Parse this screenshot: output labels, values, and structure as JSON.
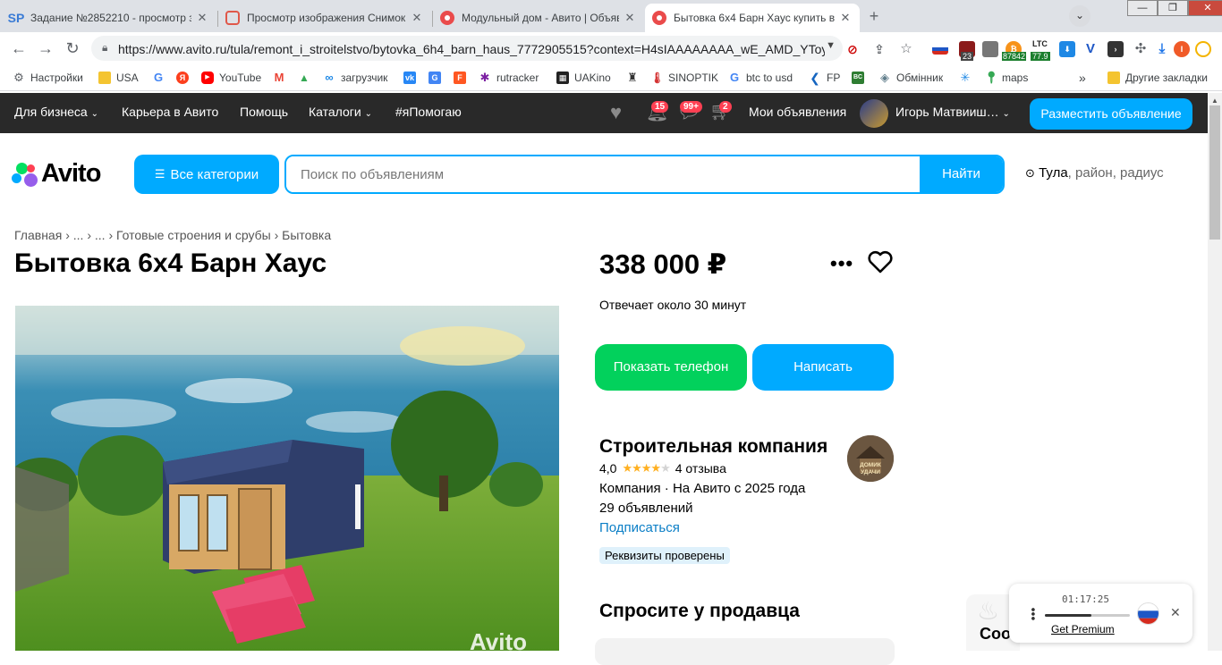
{
  "browser": {
    "tabs": [
      {
        "title": "Задание №2852210 - просмотр з",
        "favicon_text": "SP",
        "favicon_color": "#3a7bd5",
        "active": false
      },
      {
        "title": "Просмотр изображения Снимок",
        "favicon_text": "",
        "favicon_color": "#e0584a",
        "active": false
      },
      {
        "title": "Модульный дом - Авито | Объявл",
        "favicon_text": "",
        "favicon_color": "#ea4b4b",
        "active": false
      },
      {
        "title": "Бытовка 6х4 Барн Хаус купить в Т",
        "favicon_text": "",
        "favicon_color": "#ea4b4b",
        "active": true
      }
    ],
    "tab_close_glyph": "✕",
    "new_tab_glyph": "+",
    "profile_initial": "I",
    "window_controls": {
      "minimize": "—",
      "maximize": "❐",
      "close": "✕"
    },
    "url": "https://www.avito.ru/tula/remont_i_stroitelstvo/bytovka_6h4_barn_haus_7772905515?context=H4sIAAAAAAAA_wE_AMD_YToy...",
    "nav": {
      "back": "←",
      "forward": "→",
      "reload": "↻"
    },
    "extensions": [
      {
        "label": "23",
        "color": "#b22"
      },
      {
        "label": "87842",
        "color": "#1b7f2e"
      },
      {
        "label": "77.9",
        "color": "#1b7f2e"
      },
      {
        "label": "LTC",
        "color": "#444"
      }
    ],
    "bookmarks": [
      {
        "label": "Настройки",
        "icon": "gear-icon",
        "color": "#5f6368"
      },
      {
        "label": "USA",
        "icon": "folder-icon",
        "color": "#f4c430"
      },
      {
        "label": "",
        "icon": "google-icon",
        "color": "#4285f4"
      },
      {
        "label": "",
        "icon": "yandex-icon",
        "color": "#fc3f1d"
      },
      {
        "label": "YouTube",
        "icon": "youtube-icon",
        "color": "#ff0000"
      },
      {
        "label": "",
        "icon": "gmail-icon",
        "color": "#ea4335"
      },
      {
        "label": "",
        "icon": "drive-icon",
        "color": "#34a853"
      },
      {
        "label": "загрузчик",
        "icon": "link-icon",
        "color": "#1e88e5"
      },
      {
        "label": "",
        "icon": "vk-icon",
        "color": "#2787f5"
      },
      {
        "label": "",
        "icon": "translate-icon",
        "color": "#4285f4"
      },
      {
        "label": "",
        "icon": "f-icon",
        "color": "#ff5722"
      },
      {
        "label": "rutracker",
        "icon": "rutracker-icon",
        "color": "#7b1fa2"
      },
      {
        "label": "UAKino",
        "icon": "uakino-icon",
        "color": "#222"
      },
      {
        "label": "",
        "icon": "bookmark-icon",
        "color": "#333"
      },
      {
        "label": "SINOPTIK",
        "icon": "thermometer-icon",
        "color": "#d32f2f"
      },
      {
        "label": "btc to usd",
        "icon": "google-icon",
        "color": "#4285f4"
      },
      {
        "label": "FP",
        "icon": "fp-icon",
        "color": "#1565c0"
      },
      {
        "label": "",
        "icon": "bc-icon",
        "color": "#2e7d32"
      },
      {
        "label": "Обмінник",
        "icon": "exchange-icon",
        "color": "#607d8b"
      },
      {
        "label": "",
        "icon": "star-burst-icon",
        "color": "#1e88e5"
      },
      {
        "label": "maps",
        "icon": "maps-icon",
        "color": "#34a853"
      }
    ],
    "bookmarks_overflow": "»",
    "other_bookmarks": "Другие закладки"
  },
  "avito": {
    "topnav": {
      "business": "Для бизнеса",
      "career": "Карьера в Авито",
      "help": "Помощь",
      "catalogs": "Каталоги",
      "help_tag": "#яПомогаю",
      "notifications_badge": "15",
      "messages_badge": "99+",
      "cart_badge": "2",
      "my_ads": "Мои объявления",
      "user_name": "Игорь Матвииш…",
      "place_ad": "Разместить объявление"
    },
    "logo": "Avito",
    "all_categories": "Все категории",
    "search": {
      "placeholder": "Поиск по объявлениям",
      "button": "Найти"
    },
    "location": {
      "city": "Тула",
      "suffix": ", район, радиус"
    },
    "breadcrumb": [
      "Главная",
      "...",
      "...",
      "Готовые строения и срубы",
      "Бытовка"
    ],
    "breadcrumb_sep": "›",
    "title": "Бытовка 6х4 Барн Хаус",
    "price": "338 000 ₽",
    "response_time": "Отвечает около 30 минут",
    "show_phone": "Показать телефон",
    "write": "Написать",
    "seller": {
      "name": "Строительная компания",
      "rating": "4,0",
      "stars": 4,
      "reviews": "4 отзыва",
      "type_line": "Компания · На Авито с 2025 года",
      "ads_count": "29 объявлений",
      "subscribe": "Подписаться",
      "verified": "Реквизиты проверены",
      "avatar_text": "ДОМИК УДАЧИ"
    },
    "ask_seller": "Спросите у продавца",
    "photo_watermark": "Avito",
    "cookie_peek": "Coo"
  },
  "player_widget": {
    "time": "01:17:25",
    "progress": 0.55,
    "premium": "Get Premium"
  },
  "colors": {
    "accent": "#00aaff",
    "green": "#02d15c",
    "dark_header": "#292929",
    "link": "#0a7ec6",
    "star": "#ffb021"
  }
}
